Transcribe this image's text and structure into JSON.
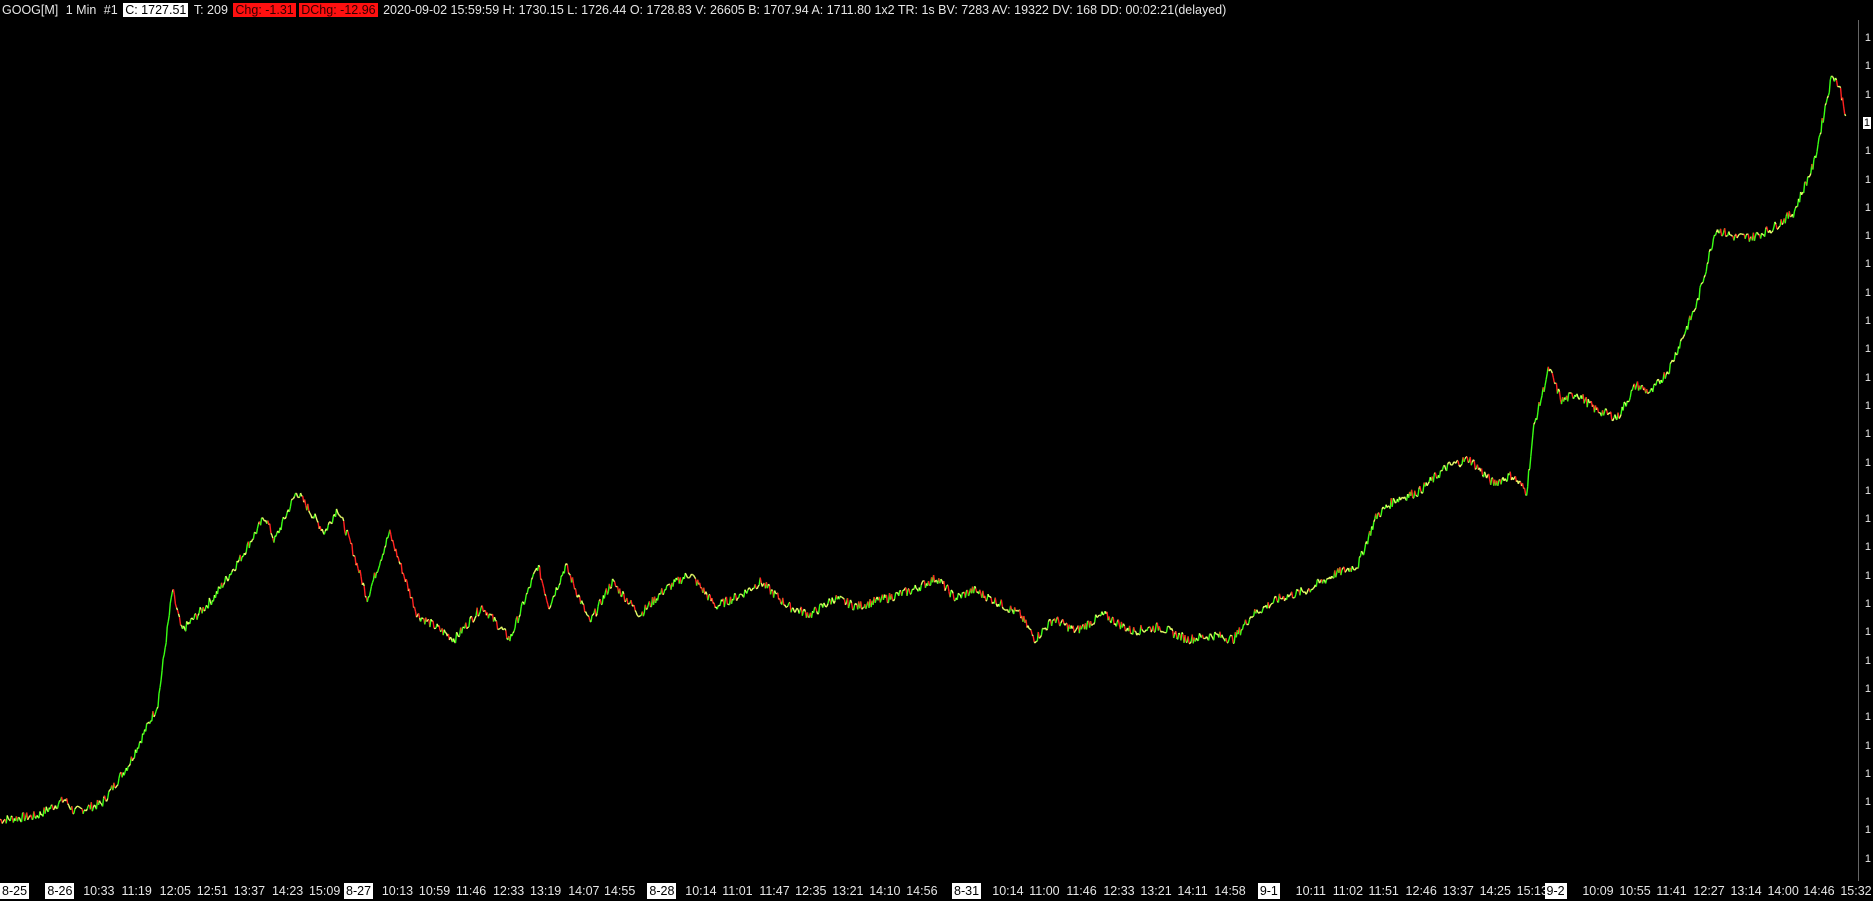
{
  "header": {
    "symbol": "GOOG[M]",
    "interval": "1 Min",
    "index": "#1",
    "close": "C: 1727.51",
    "trades": "T: 209",
    "chg": "Chg: -1.31",
    "dchg": "DChg: -12.96",
    "details": "2020-09-02 15:59:59 H: 1730.15 L: 1726.44 O: 1728.83 V: 26605 B: 1707.94 A: 1711.80 1x2 TR: 1s BV: 7283 AV: 19322 DV: 168 DD: 00:02:21(delayed)"
  },
  "colors": {
    "background": "#000000",
    "up": "#39ff14",
    "neutral": "#e8ff6a",
    "down": "#ff2020"
  },
  "x_axis": {
    "labels": [
      {
        "text": "8-25",
        "date": true
      },
      {
        "text": "8-26",
        "date": true
      },
      {
        "text": "10:33"
      },
      {
        "text": "11:19"
      },
      {
        "text": "12:05"
      },
      {
        "text": "12:51"
      },
      {
        "text": "13:37"
      },
      {
        "text": "14:23"
      },
      {
        "text": "15:09"
      },
      {
        "text": "8-27",
        "date": true
      },
      {
        "text": "10:13"
      },
      {
        "text": "10:59"
      },
      {
        "text": "11:46"
      },
      {
        "text": "12:33"
      },
      {
        "text": "13:19"
      },
      {
        "text": "14:07"
      },
      {
        "text": "14:55"
      },
      {
        "text": "8-28",
        "date": true
      },
      {
        "text": "10:14"
      },
      {
        "text": "11:01"
      },
      {
        "text": "11:47"
      },
      {
        "text": "12:35"
      },
      {
        "text": "13:21"
      },
      {
        "text": "14:10"
      },
      {
        "text": "14:56"
      },
      {
        "text": "8-31",
        "date": true
      },
      {
        "text": "10:14"
      },
      {
        "text": "11:00"
      },
      {
        "text": "11:46"
      },
      {
        "text": "12:33"
      },
      {
        "text": "13:21"
      },
      {
        "text": "14:11"
      },
      {
        "text": "14:58"
      },
      {
        "text": "9-1",
        "date": true
      },
      {
        "text": "10:11"
      },
      {
        "text": "11:02"
      },
      {
        "text": "11:51"
      },
      {
        "text": "12:46"
      },
      {
        "text": "13:37"
      },
      {
        "text": "14:25"
      },
      {
        "text": "15:13"
      },
      {
        "text": "9-2",
        "date": true
      },
      {
        "text": "10:09"
      },
      {
        "text": "10:55"
      },
      {
        "text": "11:41"
      },
      {
        "text": "12:27"
      },
      {
        "text": "13:14"
      },
      {
        "text": "14:00"
      },
      {
        "text": "14:46"
      },
      {
        "text": "15:32"
      }
    ]
  },
  "y_axis": {
    "tick_glyph": "1",
    "tick_count": 30
  },
  "chart_data": {
    "type": "line",
    "series": [
      {
        "price_points": [
          [
            0,
            0.05
          ],
          [
            0.02,
            0.055
          ],
          [
            0.035,
            0.075
          ],
          [
            0.04,
            0.06
          ],
          [
            0.055,
            0.07
          ],
          [
            0.07,
            0.12
          ],
          [
            0.085,
            0.19
          ],
          [
            0.093,
            0.33
          ],
          [
            0.098,
            0.28
          ],
          [
            0.115,
            0.32
          ],
          [
            0.13,
            0.37
          ],
          [
            0.143,
            0.42
          ],
          [
            0.148,
            0.39
          ],
          [
            0.16,
            0.45
          ],
          [
            0.175,
            0.4
          ],
          [
            0.182,
            0.43
          ],
          [
            0.19,
            0.38
          ],
          [
            0.198,
            0.32
          ],
          [
            0.21,
            0.4
          ],
          [
            0.225,
            0.3
          ],
          [
            0.245,
            0.27
          ],
          [
            0.26,
            0.31
          ],
          [
            0.275,
            0.27
          ],
          [
            0.29,
            0.36
          ],
          [
            0.296,
            0.31
          ],
          [
            0.305,
            0.36
          ],
          [
            0.318,
            0.29
          ],
          [
            0.33,
            0.34
          ],
          [
            0.345,
            0.3
          ],
          [
            0.358,
            0.33
          ],
          [
            0.372,
            0.35
          ],
          [
            0.386,
            0.31
          ],
          [
            0.4,
            0.325
          ],
          [
            0.41,
            0.34
          ],
          [
            0.425,
            0.31
          ],
          [
            0.437,
            0.3
          ],
          [
            0.45,
            0.32
          ],
          [
            0.462,
            0.31
          ],
          [
            0.478,
            0.32
          ],
          [
            0.492,
            0.33
          ],
          [
            0.505,
            0.345
          ],
          [
            0.515,
            0.32
          ],
          [
            0.525,
            0.33
          ],
          [
            0.538,
            0.315
          ],
          [
            0.55,
            0.3
          ],
          [
            0.558,
            0.27
          ],
          [
            0.568,
            0.295
          ],
          [
            0.58,
            0.28
          ],
          [
            0.595,
            0.3
          ],
          [
            0.61,
            0.28
          ],
          [
            0.625,
            0.285
          ],
          [
            0.64,
            0.27
          ],
          [
            0.655,
            0.275
          ],
          [
            0.665,
            0.27
          ],
          [
            0.675,
            0.3
          ],
          [
            0.69,
            0.32
          ],
          [
            0.705,
            0.33
          ],
          [
            0.72,
            0.35
          ],
          [
            0.732,
            0.36
          ],
          [
            0.742,
            0.42
          ],
          [
            0.752,
            0.44
          ],
          [
            0.765,
            0.45
          ],
          [
            0.78,
            0.48
          ],
          [
            0.792,
            0.49
          ],
          [
            0.805,
            0.46
          ],
          [
            0.815,
            0.47
          ],
          [
            0.823,
            0.45
          ],
          [
            0.827,
            0.53
          ],
          [
            0.835,
            0.6
          ],
          [
            0.842,
            0.56
          ],
          [
            0.85,
            0.57
          ],
          [
            0.86,
            0.55
          ],
          [
            0.872,
            0.54
          ],
          [
            0.882,
            0.58
          ],
          [
            0.89,
            0.57
          ],
          [
            0.9,
            0.6
          ],
          [
            0.915,
            0.68
          ],
          [
            0.925,
            0.77
          ],
          [
            0.935,
            0.76
          ],
          [
            0.945,
            0.76
          ],
          [
            0.955,
            0.77
          ],
          [
            0.967,
            0.79
          ],
          [
            0.978,
            0.85
          ],
          [
            0.985,
            0.93
          ],
          [
            0.988,
            0.96
          ],
          [
            0.992,
            0.94
          ],
          [
            0.995,
            0.91
          ]
        ]
      }
    ]
  }
}
